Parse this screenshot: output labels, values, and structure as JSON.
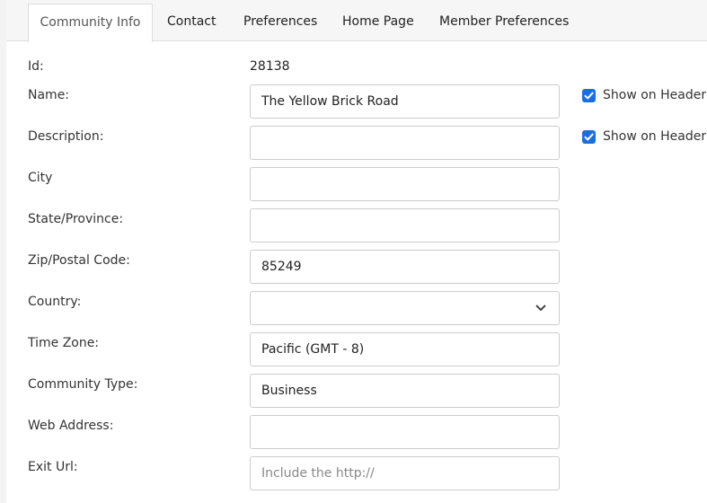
{
  "tabs": [
    {
      "label": "Community Info",
      "active": true
    },
    {
      "label": "Contact",
      "active": false
    },
    {
      "label": "Preferences",
      "active": false
    },
    {
      "label": "Home Page",
      "active": false
    },
    {
      "label": "Member Preferences",
      "active": false
    }
  ],
  "form": {
    "id_label": "Id:",
    "id_value": "28138",
    "name_label": "Name:",
    "name_value": "The Yellow Brick Road",
    "name_show_on_header": "Show on Header",
    "description_label": "Description:",
    "description_value": "",
    "description_show_on_header": "Show on Header",
    "city_label": "City",
    "city_value": "",
    "state_label": "State/Province:",
    "state_value": "",
    "zip_label": "Zip/Postal Code:",
    "zip_value": "85249",
    "country_label": "Country:",
    "country_value": "",
    "timezone_label": "Time Zone:",
    "timezone_value": "Pacific (GMT - 8)",
    "community_type_label": "Community Type:",
    "community_type_value": "Business",
    "web_address_label": "Web Address:",
    "web_address_value": "",
    "exit_url_label": "Exit Url:",
    "exit_url_placeholder": "Include the http://"
  },
  "colors": {
    "checkbox_checked": "#1a6fe0",
    "tabbar_bg": "#f6f6f6"
  },
  "icons": {
    "checkbox": "check-icon",
    "select": "chevron-down-icon"
  }
}
